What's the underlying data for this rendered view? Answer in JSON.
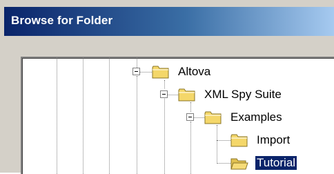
{
  "window": {
    "title": "Browse for Folder"
  },
  "tree": {
    "items": [
      {
        "label": "Altova",
        "expanded": true,
        "icon": "folder-closed-icon"
      },
      {
        "label": "XML Spy Suite",
        "expanded": true,
        "icon": "folder-closed-icon"
      },
      {
        "label": "Examples",
        "expanded": true,
        "icon": "folder-closed-icon"
      },
      {
        "label": "Import",
        "expanded": false,
        "icon": "folder-closed-icon"
      },
      {
        "label": "Tutorial",
        "expanded": false,
        "selected": true,
        "icon": "folder-open-icon"
      }
    ]
  },
  "colors": {
    "title_start": "#0a246a",
    "title_end": "#a6caf0",
    "selection": "#0a246a",
    "folder": "#f4d76a"
  }
}
